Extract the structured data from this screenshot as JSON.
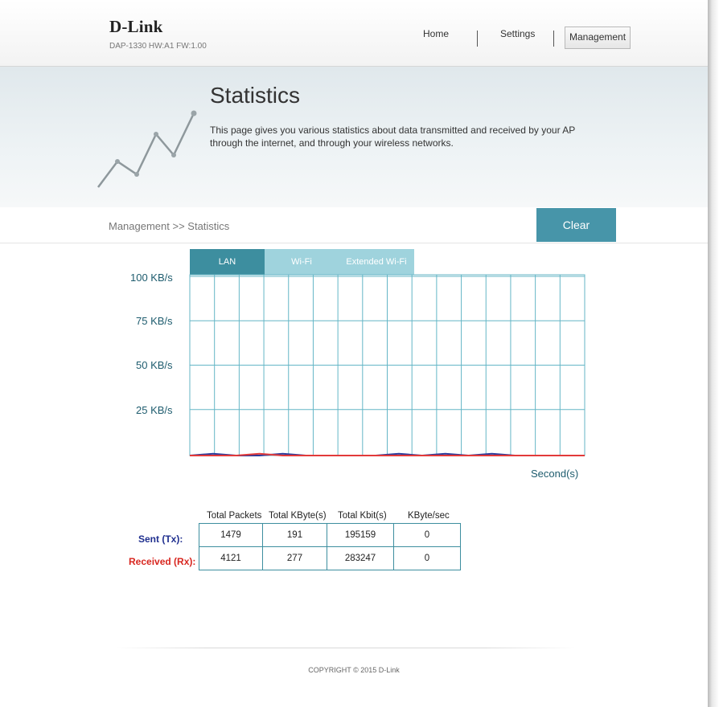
{
  "header": {
    "brand": "D-Link",
    "model_info": "DAP-1330   HW:A1   FW:1.00",
    "nav": {
      "home": "Home",
      "settings": "Settings",
      "management": "Management"
    }
  },
  "banner": {
    "title": "Statistics",
    "description": "This page gives you various statistics about data transmitted and received by your AP through the internet, and through your wireless networks."
  },
  "breadcrumb": "Management >> Statistics",
  "clear_button": "Clear",
  "tabs": [
    "LAN",
    "Wi-Fi",
    "Extended Wi-Fi"
  ],
  "active_tab": "LAN",
  "chart_data": {
    "type": "line",
    "y_tick_labels": [
      "100 KB/s",
      "75 KB/s",
      "50 KB/s",
      "25 KB/s"
    ],
    "xlabel": "Second(s)",
    "ylim": [
      0,
      100
    ],
    "x": [
      0,
      1,
      2,
      3,
      4,
      5,
      6,
      7,
      8,
      9,
      10,
      11,
      12,
      13,
      14,
      15,
      16,
      17
    ],
    "series": [
      {
        "color": "#2b3a9a",
        "values": [
          0,
          1,
          0,
          0,
          1,
          0,
          0,
          0,
          0,
          1,
          0,
          1,
          0,
          1,
          0,
          0,
          0,
          0
        ]
      },
      {
        "color": "#e23a3a",
        "values": [
          0,
          0,
          0,
          1,
          0,
          0,
          0,
          0,
          0,
          0,
          0,
          0,
          0,
          0,
          0,
          0,
          0,
          0
        ]
      }
    ],
    "grid": true
  },
  "stats": {
    "columns": [
      "Total Packets",
      "Total KByte(s)",
      "Total Kbit(s)",
      "KByte/sec"
    ],
    "sent": {
      "label": "Sent (Tx):",
      "color": "#1f2f8f",
      "values": [
        "1479",
        "191",
        "195159",
        "0"
      ]
    },
    "received": {
      "label": "Received (Rx):",
      "color": "#d8261f",
      "values": [
        "4121",
        "277",
        "283247",
        "0"
      ]
    }
  },
  "footer": {
    "copyright": "COPYRIGHT © 2015 D-Link"
  }
}
